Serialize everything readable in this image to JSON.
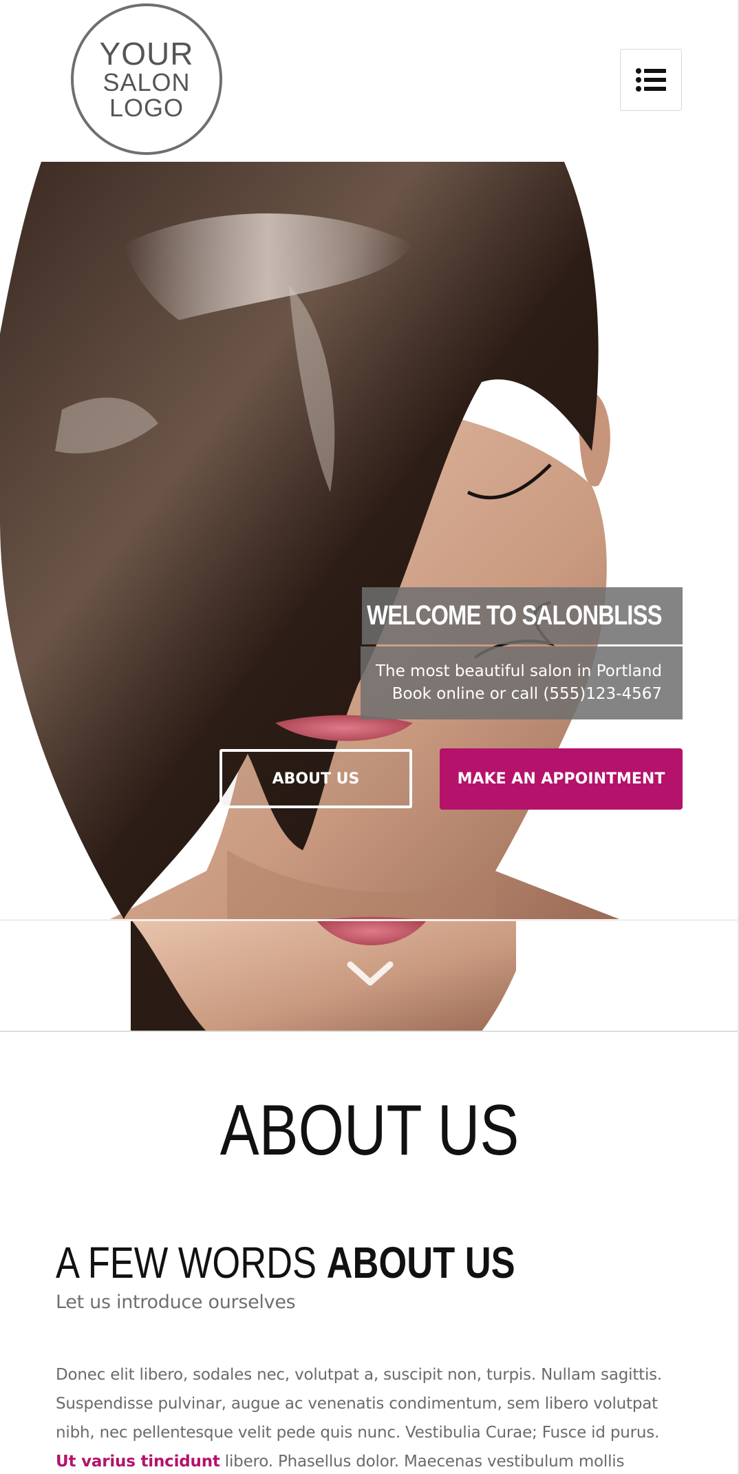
{
  "header": {
    "logo": {
      "line1": "YOUR",
      "line2": "SALON",
      "line3": "LOGO"
    },
    "menu_icon": "list-icon"
  },
  "hero": {
    "title": "WELCOME TO SALONBLISS",
    "subtitle_line1": "The most beautiful salon in Portland",
    "subtitle_line2": "Book online or call (555)123-4567",
    "about_button": "ABOUT US",
    "appointment_button": "MAKE AN APPOINTMENT",
    "scroll_icon": "chevron-down-icon"
  },
  "about": {
    "heading": "ABOUT US",
    "subheading_light": "A FEW WORDS ",
    "subheading_bold": "ABOUT US",
    "intro": "Let us introduce ourselves",
    "body_before_link": "Donec elit libero, sodales nec, volutpat a, suscipit non, turpis. Nullam sagittis. Suspendisse pulvinar, augue ac venenatis condimentum, sem libero volutpat nibh, nec pellentesque velit pede quis nunc. Vestibulia Curae; Fusce id purus. ",
    "body_link": "Ut varius tincidunt",
    "body_after_link": " libero. Phasellus dolor. Maecenas vestibulum mollis"
  },
  "colors": {
    "accent": "#b5126b",
    "overlay": "#6e6e6e",
    "heading": "#111111",
    "body_text": "#6a6a6a",
    "logo": "#6f6f6f"
  }
}
